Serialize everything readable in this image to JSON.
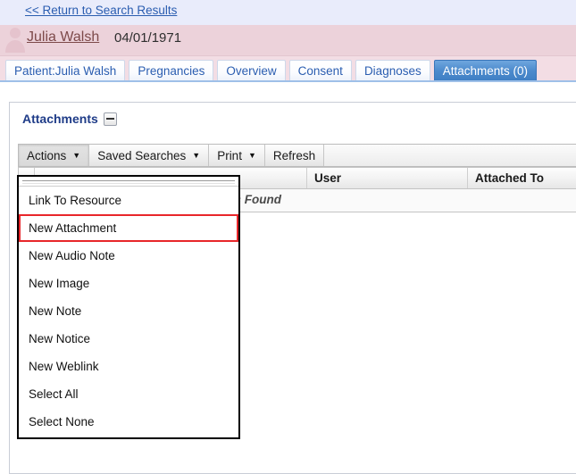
{
  "top": {
    "return_link": "<< Return to Search Results"
  },
  "patient": {
    "name": "Julia Walsh",
    "dob": "04/01/1971",
    "watermark_icon": "patient-silhouette-icon"
  },
  "tabs": [
    {
      "label": "Patient:Julia Walsh",
      "active": false
    },
    {
      "label": "Pregnancies",
      "active": false
    },
    {
      "label": "Overview",
      "active": false
    },
    {
      "label": "Consent",
      "active": false
    },
    {
      "label": "Diagnoses",
      "active": false
    },
    {
      "label": "Attachments (0)",
      "active": true
    }
  ],
  "panel": {
    "title": "Attachments",
    "collapse_icon": "minus-icon"
  },
  "toolbar": {
    "actions_label": "Actions",
    "saved_searches_label": "Saved Searches",
    "print_label": "Print",
    "refresh_label": "Refresh",
    "caret_glyph": "▼"
  },
  "table": {
    "columns": [
      "",
      "",
      "User",
      "Attached To"
    ],
    "empty_message": "No Items Found",
    "rows": []
  },
  "menu": {
    "items": [
      {
        "label": "Link To Resource",
        "highlighted": false
      },
      {
        "label": "New Attachment",
        "highlighted": true
      },
      {
        "label": "New Audio Note",
        "highlighted": false
      },
      {
        "label": "New Image",
        "highlighted": false
      },
      {
        "label": "New Note",
        "highlighted": false
      },
      {
        "label": "New Notice",
        "highlighted": false
      },
      {
        "label": "New Weblink",
        "highlighted": false
      },
      {
        "label": "Select All",
        "highlighted": false
      },
      {
        "label": "Select None",
        "highlighted": false
      }
    ]
  },
  "colors": {
    "top_band": "#e9ecfb",
    "patient_band": "#ecd2da",
    "tab_strip": "#f3dde4",
    "link_blue": "#2a5db0",
    "patient_link": "#7d4a4a",
    "active_tab": "#4d8bcd",
    "panel_title": "#1f3c88",
    "highlight_red": "#e8262a"
  }
}
